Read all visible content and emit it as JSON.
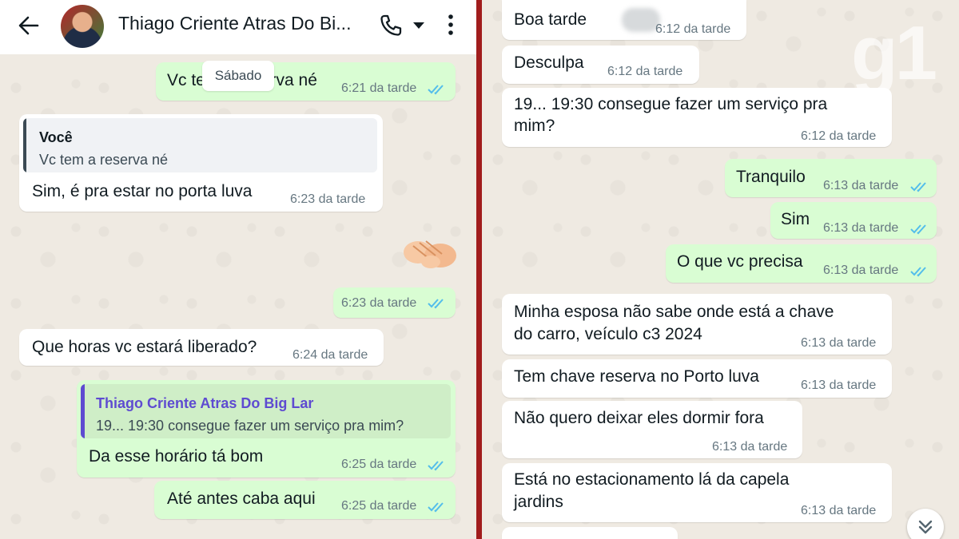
{
  "header": {
    "contact_name": "Thiago Criente Atras Do Bi..."
  },
  "date_chip": "Sábado",
  "watermark": "g1",
  "colors": {
    "outgoing_bubble": "#d9fdd3",
    "incoming_bubble": "#ffffff",
    "read_ticks": "#53bdeb",
    "divider": "#a11d1d",
    "quote_own": "#06a884",
    "quote_contact": "#5e4bd1"
  },
  "left_chat": {
    "m1": {
      "text": "Vc tem a reserva né",
      "time": "6:21 da tarde"
    },
    "m2": {
      "quote_author": "Você",
      "quote_text": "Vc tem a reserva né",
      "text": "Sim, é pra estar no porta luva",
      "time": "6:23 da tarde"
    },
    "m3": {
      "emoji": "handshake-icon",
      "time": "6:23 da tarde"
    },
    "m4": {
      "text": "Que horas vc estará liberado?",
      "time": "6:24 da tarde"
    },
    "m5": {
      "quote_author": "Thiago Criente Atras Do Big Lar",
      "quote_text": "19... 19:30 consegue fazer um serviço pra mim?",
      "text": "Da esse horário tá bom",
      "time": "6:25 da tarde"
    },
    "m6": {
      "text": "Até antes caba aqui",
      "time": "6:25 da tarde"
    }
  },
  "right_chat": {
    "r1": {
      "text": "Boa tarde",
      "time": "6:12 da tarde"
    },
    "r2": {
      "text": "Desculpa",
      "time": "6:12 da tarde"
    },
    "r3": {
      "line1": "19... 19:30 consegue fazer um serviço pra",
      "line2": "mim?",
      "time": "6:12 da tarde"
    },
    "r4": {
      "text": "Tranquilo",
      "time": "6:13 da tarde"
    },
    "r5": {
      "text": "Sim",
      "time": "6:13 da tarde"
    },
    "r6": {
      "text": "O que vc precisa",
      "time": "6:13 da tarde"
    },
    "r7": {
      "line1": "Minha esposa não sabe onde está a chave",
      "line2": "do carro, veículo c3 2024",
      "time": "6:13 da tarde"
    },
    "r8": {
      "text": "Tem chave reserva no Porto luva",
      "time": "6:13 da tarde"
    },
    "r9": {
      "text": "Não quero deixar eles dormir fora",
      "time": "6:13 da tarde"
    },
    "r10": {
      "line1": "Está no estacionamento lá da capela",
      "line2": "jardins",
      "time": "6:13 da tarde"
    }
  }
}
